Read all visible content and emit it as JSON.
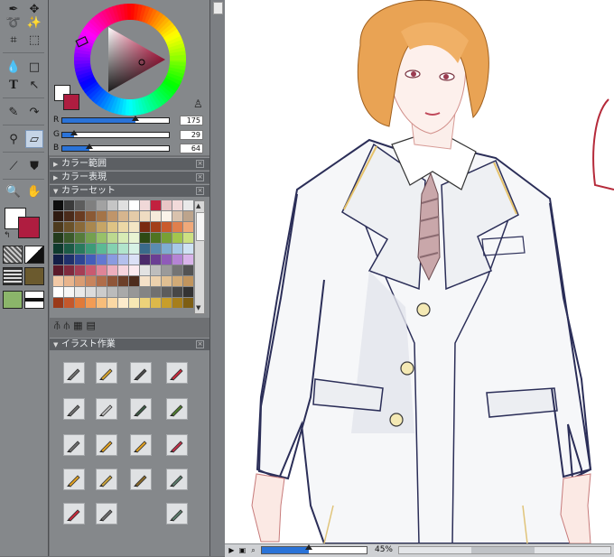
{
  "color_panel": {
    "sliders": [
      {
        "label": "R",
        "value": "175",
        "fraction": 0.686
      },
      {
        "label": "G",
        "value": "29",
        "fraction": 0.114
      },
      {
        "label": "B",
        "value": "64",
        "fraction": 0.251
      }
    ],
    "main_color": "#af1d40",
    "sub_color": "#ffffff"
  },
  "panels": {
    "color_range": "カラー範囲",
    "color_expression": "カラー表現",
    "color_set": "カラーセット",
    "illust_work": "イラスト作業"
  },
  "status": {
    "zoom": "45%",
    "zoom_fraction": 0.45
  },
  "swatches": [
    "#0d0d0d",
    "#3b3b3b",
    "#5d5d5d",
    "#7f7f7f",
    "#a2a2a2",
    "#c5c5c5",
    "#e0e0e0",
    "#ffffff",
    "#f0d8d8",
    "#c2213f",
    "#e8c6c6",
    "#f2dada",
    "#e9e9e9",
    "#2e1a10",
    "#4b2b1a",
    "#6a3c22",
    "#8b5a35",
    "#a47448",
    "#c0956a",
    "#d6b58e",
    "#e4cba8",
    "#efdcc2",
    "#f6eadb",
    "#fbf3ea",
    "#d9c2ad",
    "#bda48c",
    "#4d3a1d",
    "#6b522a",
    "#8a6a3a",
    "#a9874f",
    "#c6a566",
    "#dec384",
    "#ecd8a6",
    "#f3e6c4",
    "#7a2a10",
    "#a33e1a",
    "#c95b2e",
    "#e07f4d",
    "#f0a97a",
    "#233b1c",
    "#3b5a2b",
    "#567c3c",
    "#74a04f",
    "#97c169",
    "#bcd98f",
    "#d7ebb5",
    "#e9f4d3",
    "#2e4a14",
    "#4f7421",
    "#77a035",
    "#a3c64e",
    "#cde082",
    "#0f3a2d",
    "#1c5a45",
    "#2a7a5e",
    "#3d9b78",
    "#5cba94",
    "#84d1b0",
    "#b1e4cc",
    "#d7f2e5",
    "#3a6a8a",
    "#5a8cb0",
    "#7fadd0",
    "#a7c9e6",
    "#cfe2f3",
    "#131e46",
    "#1f306b",
    "#2e4593",
    "#445dba",
    "#6378d1",
    "#8a9be0",
    "#b4c0ec",
    "#dbe1f6",
    "#4a2a6a",
    "#6b3f94",
    "#8f5bb9",
    "#b584d5",
    "#d9b4ea",
    "#5a1a2a",
    "#7f2a3e",
    "#a53e55",
    "#c95a70",
    "#df8497",
    "#edafbe",
    "#f6d5de",
    "#fbeaef",
    "#e2e2e2",
    "#bdbdbd",
    "#9a9a9a",
    "#747474",
    "#535353",
    "#f2c9a6",
    "#e8b48c",
    "#d99c72",
    "#c8845d",
    "#b06d4a",
    "#8f5538",
    "#6c3f29",
    "#4d2c1d",
    "#f5e1c8",
    "#ecd1ad",
    "#e0bf92",
    "#d2ab77",
    "#c1955e",
    "#ffffff",
    "#f6f6f6",
    "#eaeaea",
    "#dcdcdc",
    "#cccccc",
    "#bbbbbb",
    "#a9a9a9",
    "#979797",
    "#848484",
    "#707070",
    "#5c5c5c",
    "#474747",
    "#333333",
    "#9a3a1a",
    "#c4582c",
    "#e07a3a",
    "#f29c55",
    "#f7bd7a",
    "#fbd8a4",
    "#fdebcc",
    "#f7e8b4",
    "#ecd27a",
    "#dcb84a",
    "#c89e2a",
    "#a67e1c",
    "#7d5e14"
  ],
  "icons": {
    "toolbar": [
      "pen-icon",
      "move-icon",
      "lasso-icon",
      "magic-wand-icon",
      "crop-icon",
      "selection-icon",
      "fill-drop-icon",
      "rectangle-icon",
      "text-icon",
      "arrow-select-icon",
      "brush-tool-icon",
      "curve-icon",
      "airbrush-icon",
      "eraser-icon",
      "eyedropper-icon",
      "bucket-icon",
      "zoom-icon",
      "hand-icon"
    ]
  }
}
